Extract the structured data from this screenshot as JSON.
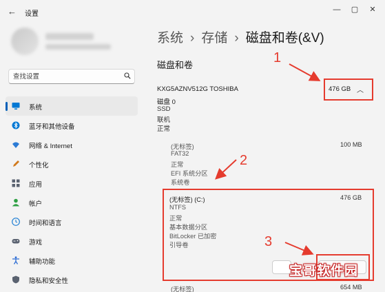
{
  "window": {
    "title": "设置",
    "back_icon": "back-arrow-icon",
    "controls": [
      "—",
      "▢",
      "✕"
    ]
  },
  "search": {
    "placeholder": "查找设置"
  },
  "sidebar": {
    "items": [
      {
        "label": "系统",
        "icon": "monitor-icon",
        "color": "#0078d4",
        "active": true
      },
      {
        "label": "蓝牙和其他设备",
        "icon": "bluetooth-icon",
        "color": "#0078d4"
      },
      {
        "label": "网络 & Internet",
        "icon": "wifi-icon",
        "color": "#2b7bd5"
      },
      {
        "label": "个性化",
        "icon": "pencil-icon",
        "color": "#d17a1d"
      },
      {
        "label": "应用",
        "icon": "apps-icon",
        "color": "#5a6270"
      },
      {
        "label": "帐户",
        "icon": "account-icon",
        "color": "#2ea043"
      },
      {
        "label": "时间和语言",
        "icon": "globe-clock-icon",
        "color": "#1f7fd4"
      },
      {
        "label": "游戏",
        "icon": "gamepad-icon",
        "color": "#5a6270"
      },
      {
        "label": "辅助功能",
        "icon": "accessibility-icon",
        "color": "#2b6cd4"
      },
      {
        "label": "隐私和安全性",
        "icon": "shield-icon",
        "color": "#5a6270"
      }
    ]
  },
  "breadcrumb": {
    "items": [
      "系统",
      "存储",
      "磁盘和卷(&V)"
    ],
    "separator": "›"
  },
  "section_title": "磁盘和卷",
  "disk": {
    "name": "KXG5AZNV512G TOSHIBA",
    "size": "476 GB",
    "label": "磁盘 0",
    "type": "SSD",
    "status1": "联机",
    "status2": "正常"
  },
  "partitions": [
    {
      "label": "(无标签)",
      "fs": "FAT32",
      "health": "正常",
      "kind": "EFI 系统分区",
      "role": "系统卷",
      "size": "100 MB"
    },
    {
      "label": "(无标签) (C:)",
      "fs": "NTFS",
      "health": "正常",
      "kind": "基本数据分区",
      "bitlocker": "BitLocker 已加密",
      "role": "引导卷",
      "size": "476 GB"
    },
    {
      "label": "(无标签)",
      "size": "654 MB"
    }
  ],
  "annotations": {
    "n1": "1",
    "n2": "2",
    "n3": "3",
    "color": "#e53b2e"
  },
  "watermark": "宝哥软件园"
}
